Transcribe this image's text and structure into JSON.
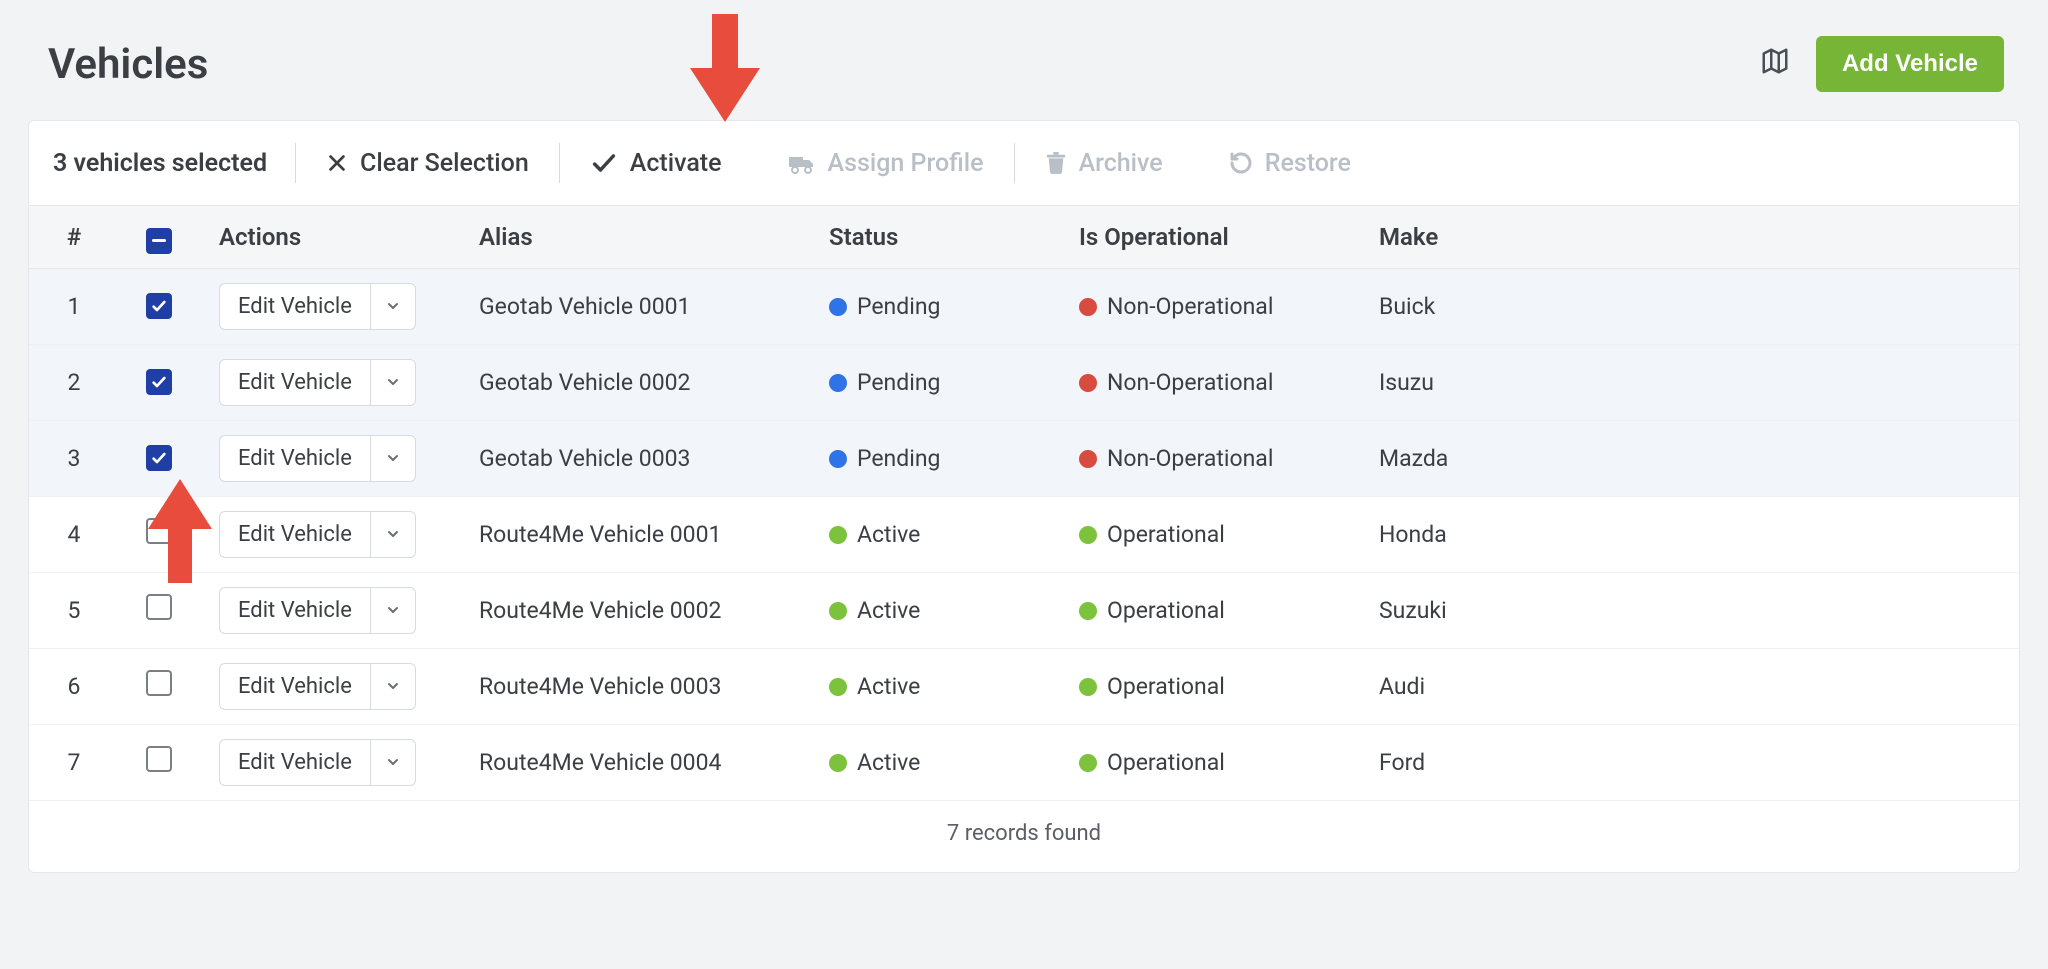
{
  "page": {
    "title": "Vehicles"
  },
  "header": {
    "add_label": "Add Vehicle"
  },
  "toolbar": {
    "selected_count": "3 vehicles selected",
    "clear_label": "Clear Selection",
    "activate_label": "Activate",
    "assign_label": "Assign Profile",
    "archive_label": "Archive",
    "restore_label": "Restore"
  },
  "table": {
    "headers": {
      "num": "#",
      "actions": "Actions",
      "alias": "Alias",
      "status": "Status",
      "is_operational": "Is Operational",
      "make": "Make"
    },
    "action_label": "Edit Vehicle",
    "rows": [
      {
        "num": "1",
        "checked": true,
        "alias": "Geotab Vehicle 0001",
        "status": "Pending",
        "status_color": "blue",
        "op": "Non-Operational",
        "op_color": "red",
        "make": "Buick"
      },
      {
        "num": "2",
        "checked": true,
        "alias": "Geotab Vehicle 0002",
        "status": "Pending",
        "status_color": "blue",
        "op": "Non-Operational",
        "op_color": "red",
        "make": "Isuzu"
      },
      {
        "num": "3",
        "checked": true,
        "alias": "Geotab Vehicle 0003",
        "status": "Pending",
        "status_color": "blue",
        "op": "Non-Operational",
        "op_color": "red",
        "make": "Mazda"
      },
      {
        "num": "4",
        "checked": false,
        "alias": "Route4Me Vehicle 0001",
        "status": "Active",
        "status_color": "green",
        "op": "Operational",
        "op_color": "green",
        "make": "Honda"
      },
      {
        "num": "5",
        "checked": false,
        "alias": "Route4Me Vehicle 0002",
        "status": "Active",
        "status_color": "green",
        "op": "Operational",
        "op_color": "green",
        "make": "Suzuki"
      },
      {
        "num": "6",
        "checked": false,
        "alias": "Route4Me Vehicle 0003",
        "status": "Active",
        "status_color": "green",
        "op": "Operational",
        "op_color": "green",
        "make": "Audi"
      },
      {
        "num": "7",
        "checked": false,
        "alias": "Route4Me Vehicle 0004",
        "status": "Active",
        "status_color": "green",
        "op": "Operational",
        "op_color": "green",
        "make": "Ford"
      }
    ],
    "footer": "7 records found"
  },
  "colors": {
    "accent_blue": "#1f3fa6",
    "primary_green": "#76b536"
  }
}
